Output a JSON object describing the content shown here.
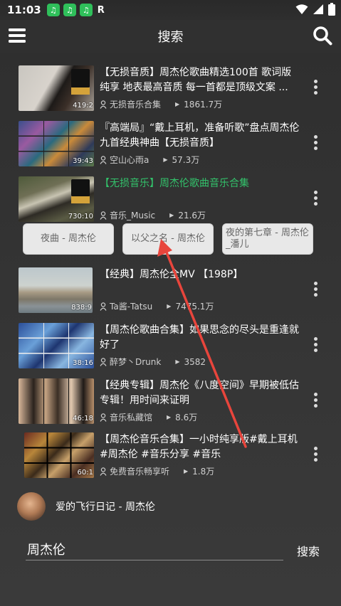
{
  "status_bar": {
    "time": "11:03",
    "app_badges": [
      "music-app-icon",
      "music-app-icon",
      "music-app-icon"
    ],
    "extra_badge": "R"
  },
  "header": {
    "title": "搜索"
  },
  "videos": [
    {
      "title": "【无损音质】周杰伦歌曲精选100首 歌词版纯享 地表最高音质 每一首都是顶级文案 ...",
      "author": "无损音乐合集",
      "plays": "1861.7万",
      "duration": "419:2",
      "active": false
    },
    {
      "title": "『高端局』“戴上耳机，准备听歌”盘点周杰伦九首经典神曲【无损音质】",
      "author": "空山心雨a",
      "plays": "57.3万",
      "duration": "39:43",
      "active": false
    },
    {
      "title": "【无损音乐】周杰伦歌曲音乐合集",
      "author": "音乐_Music",
      "plays": "21.6万",
      "duration": "730:10",
      "active": true
    },
    {
      "title": "【经典】周杰伦全MV 【198P】",
      "author": "Ta酱-Tatsu",
      "plays": "7475.1万",
      "duration": "838:9",
      "active": false
    },
    {
      "title": "【周杰伦歌曲合集】如果思念的尽头是重逢就好了",
      "author": "醉梦丶Drunk",
      "plays": "3582",
      "duration": "38:16",
      "active": false
    },
    {
      "title": "【经典专辑】周杰伦《八度空间》早期被低估专辑！用时间来证明",
      "author": "音乐私藏馆",
      "plays": "8.6万",
      "duration": "46:18",
      "active": false
    },
    {
      "title": "【周杰伦音乐合集】一小时纯享版#戴上耳机 #周杰伦 #音乐分享 #音乐",
      "author": "免费音乐畅享听",
      "plays": "1.8万",
      "duration": "60:1",
      "active": false
    }
  ],
  "song_chips": [
    "夜曲 - 周杰伦",
    "以父之名 - 周杰伦",
    "夜的第七章 - 周杰伦 _潘儿"
  ],
  "now_playing": {
    "title": "爱的飞行日记 - 周杰伦"
  },
  "search": {
    "value": "周杰伦",
    "submit_label": "搜索"
  },
  "colors": {
    "background": "#3a3a3a",
    "active_title": "#33c26b",
    "annotation_arrow": "#e8453c"
  }
}
